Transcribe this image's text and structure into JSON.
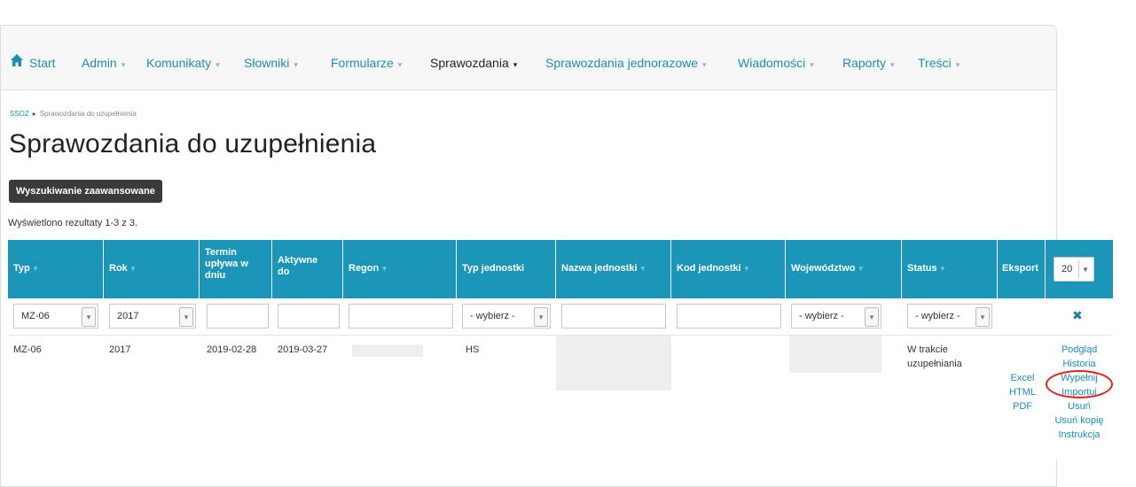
{
  "nav": {
    "items": [
      {
        "label": "Start",
        "active": false,
        "caret": false
      },
      {
        "label": "Admin",
        "active": false,
        "caret": true
      },
      {
        "label": "Komunikaty",
        "active": false,
        "caret": true
      },
      {
        "label": "Słowniki",
        "active": false,
        "caret": true
      },
      {
        "label": "Formularze",
        "active": false,
        "caret": true
      },
      {
        "label": "Sprawozdania",
        "active": true,
        "caret": true
      },
      {
        "label": "Sprawozdania jednorazowe",
        "active": false,
        "caret": true
      },
      {
        "label": "Wiadomości",
        "active": false,
        "caret": true
      },
      {
        "label": "Raporty",
        "active": false,
        "caret": true
      },
      {
        "label": "Treści",
        "active": false,
        "caret": true
      }
    ],
    "home_icon": "home-icon",
    "caret_glyph": "▾"
  },
  "breadcrumb": {
    "root": "SSOZ",
    "sep": "▸",
    "current": "Sprawozdania do uzupełnienia"
  },
  "page_title": "Sprawozdania do uzupełnienia",
  "advanced_search_label": "Wyszukiwanie zaawansowane",
  "results_text": "Wyświetlono rezultaty 1-3 z 3.",
  "table": {
    "headers": {
      "typ": "Typ",
      "rok": "Rok",
      "termin": "Termin upływa w dniu",
      "aktywne": "Aktywne do",
      "regon": "Regon",
      "typ_jednostki": "Typ jednostki",
      "nazwa": "Nazwa jednostki",
      "kod": "Kod jednostki",
      "wojewodztwo": "Województwo",
      "status": "Status",
      "eksport": "Eksport"
    },
    "per_page": "20",
    "filters": {
      "typ": "MZ-06",
      "rok": "2017",
      "typ_jednostki": "- wybierz -",
      "wojewodztwo": "- wybierz -",
      "status": "- wybierz -",
      "clear_icon": "✖"
    },
    "row": {
      "typ": "MZ-06",
      "rok": "2017",
      "termin": "2019-02-28",
      "aktywne": "2019-03-27",
      "typ_jednostki": "HS",
      "status_line1": "W trakcie",
      "status_line2": "uzupełniania",
      "export": [
        "Excel",
        "HTML",
        "PDF"
      ],
      "actions": [
        "Podgląd",
        "Historia",
        "Wypełnij",
        "Importuj",
        "Usuń",
        "Usuń kopię",
        "Instrukcja"
      ]
    }
  },
  "colors": {
    "header_bg": "#1b96b8",
    "link": "#1a8fb3",
    "highlight": "#e32020"
  }
}
